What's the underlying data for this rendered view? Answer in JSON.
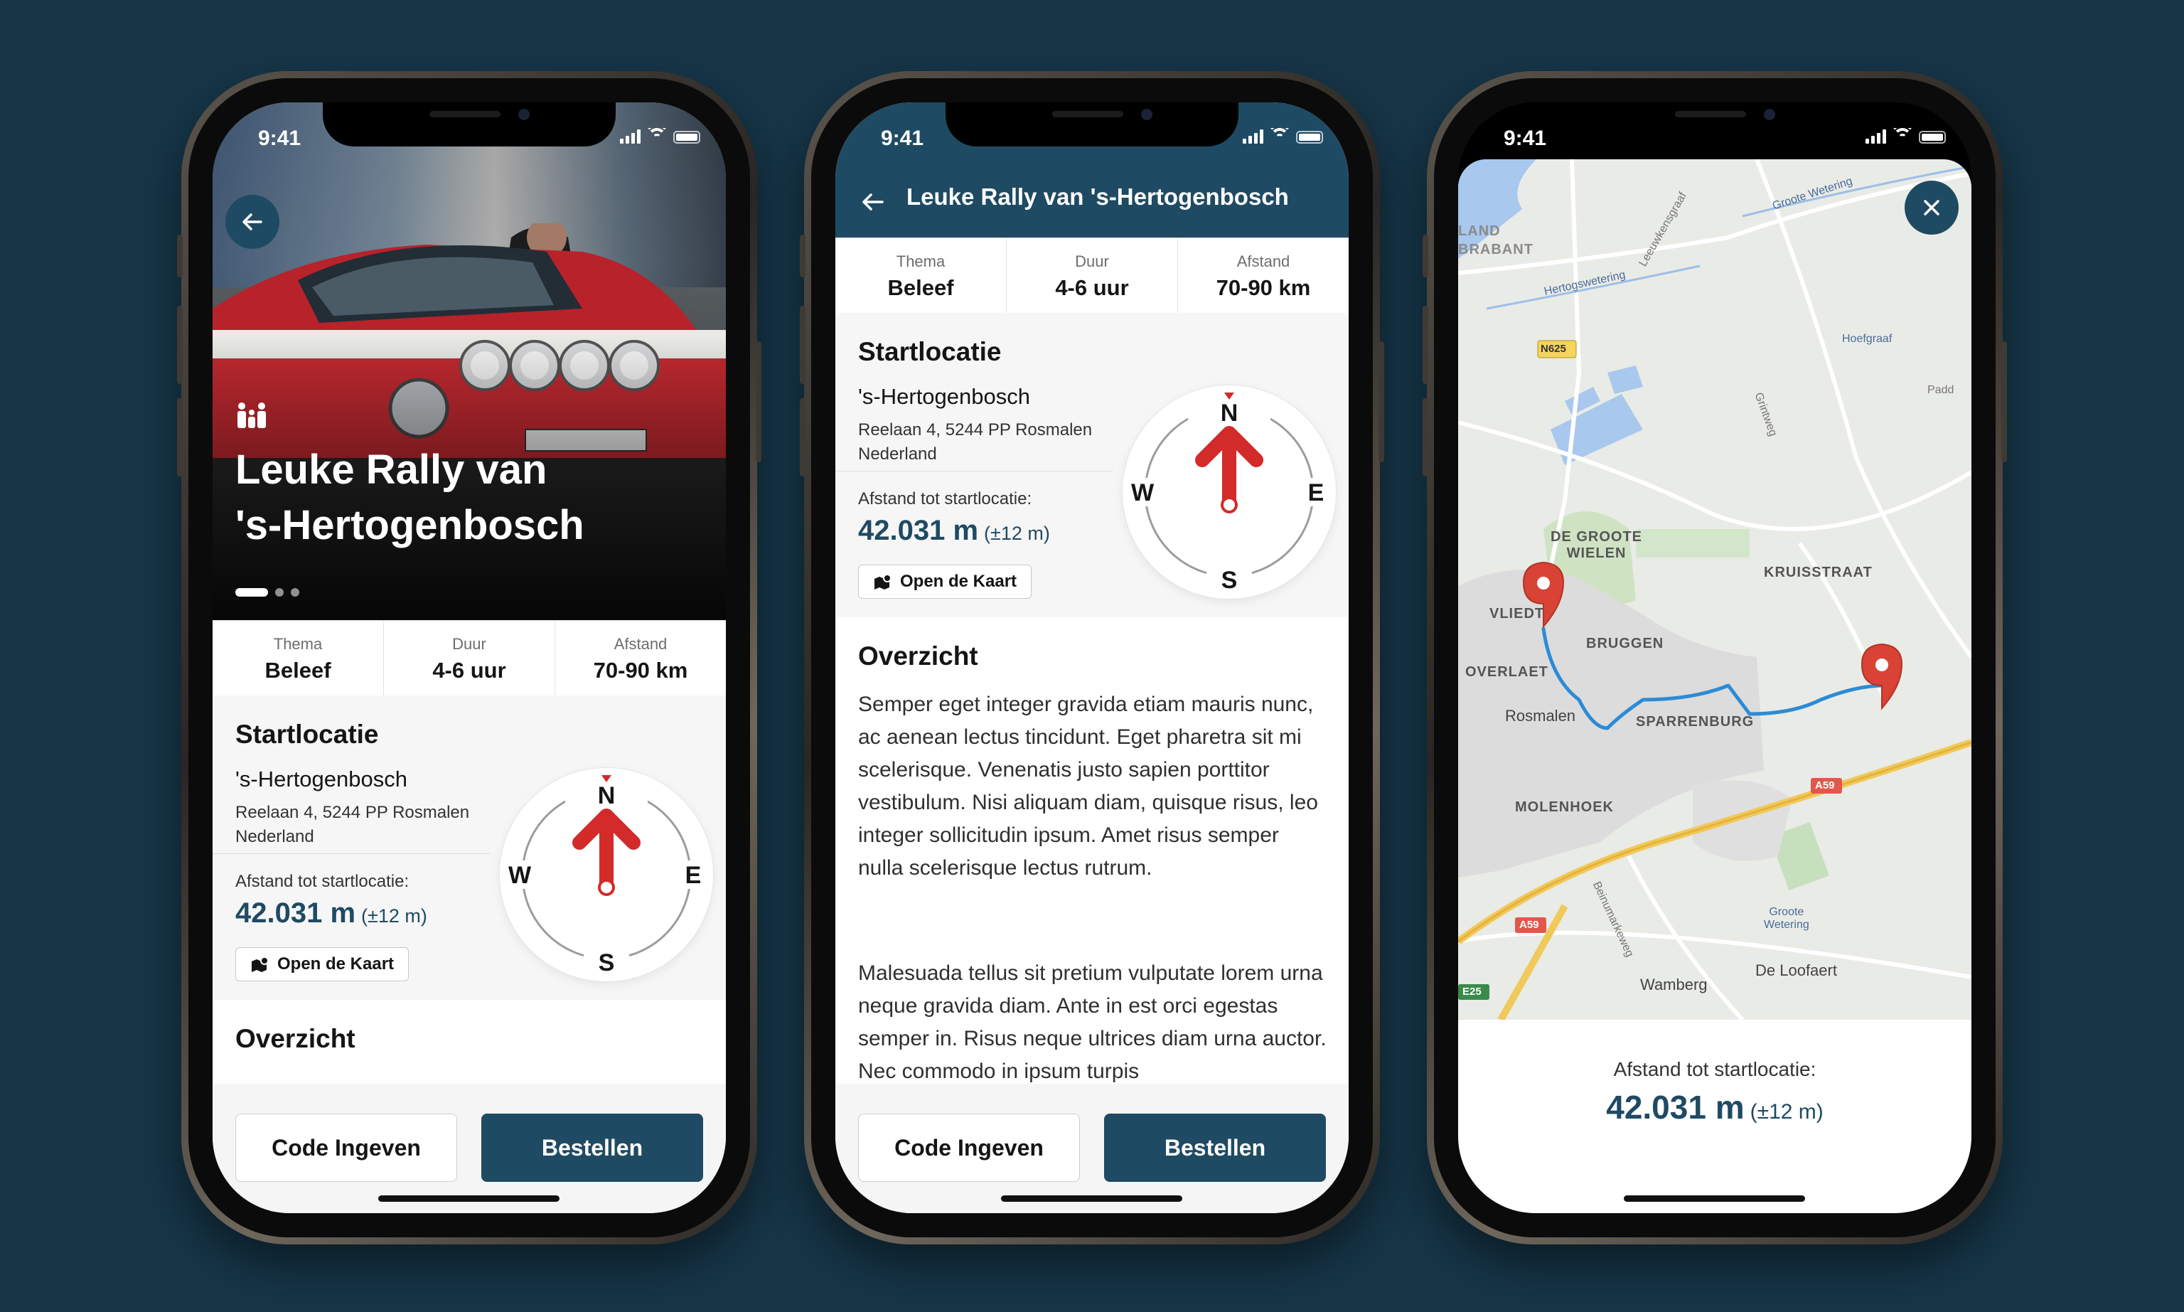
{
  "status": {
    "time": "9:41"
  },
  "ride": {
    "title": "Leuke Rally van 's-Hertogenbosch",
    "hero_title_line1": "Leuke Rally van",
    "hero_title_line2": "'s-Hertogenbosch",
    "carousel": {
      "pages": 3,
      "active": 1
    }
  },
  "info": [
    {
      "key": "Thema",
      "value": "Beleef"
    },
    {
      "key": "Duur",
      "value": "4-6 uur"
    },
    {
      "key": "Afstand",
      "value": "70-90 km"
    }
  ],
  "start": {
    "heading": "Startlocatie",
    "city": "'s-Hertogenbosch",
    "address_line1": "Reelaan 4, 5244 PP Rosmalen",
    "address_line2": "Nederland",
    "distance_label": "Afstand tot startlocatie:",
    "distance_value": "42.031 m",
    "distance_accuracy": "(±12 m)",
    "map_button": "Open de Kaart"
  },
  "compass": {
    "n": "N",
    "e": "E",
    "s": "S",
    "w": "W"
  },
  "overview": {
    "heading": "Overzicht",
    "para1": "Semper eget integer gravida etiam mauris nunc, ac aenean lectus tincidunt. Eget pharetra sit mi scelerisque. Venenatis justo sapien porttitor vestibulum. Nisi aliquam diam, quisque risus, leo integer sollicitudin ipsum. Amet risus semper nulla scelerisque lectus rutrum.",
    "para2": "Malesuada tellus sit pretium vulputate lorem urna neque gravida diam. Ante in est orci egestas semper in. Risus neque ultrices diam urna auctor. Nec commodo in ipsum turpis"
  },
  "actions": {
    "code": "Code Ingeven",
    "order": "Bestellen"
  },
  "map": {
    "labels": {
      "de_groote_wielen": "DE GROOTE\nWIELEN",
      "kruisstraat": "KRUISSTRAAT",
      "bruggen": "BRUGGEN",
      "overlaet": "OVERLAET",
      "vlied": "VLIEDT",
      "sparrenburg": "SPARRENBURG",
      "molenhoek": "MOLENHOEK",
      "rosmalen": "Rosmalen",
      "wamberg": "Wamberg",
      "de_loofaert": "De Loofaert",
      "hoefgraaf": "Hoefgraaf",
      "land": "LAND",
      "brabant": "BRABANT",
      "hertogswetering": "Hertogswetering",
      "groote_wetering": "Groote Wetering",
      "groote_wetering_2": "Groote\nWetering",
      "n625": "N625",
      "a59": "A59",
      "a59_2": "A59",
      "e25": "E25",
      "padd": "Padd",
      "leeuwkensgraaf": "Leeuwkensgraaf",
      "grintweg": "Grintweg",
      "beinumarkeweg": "Beinumarkeweg"
    }
  },
  "colors": {
    "background": "#163547",
    "accent": "#1f4a63",
    "pin": "#d84336",
    "route": "#2d8bd6"
  }
}
